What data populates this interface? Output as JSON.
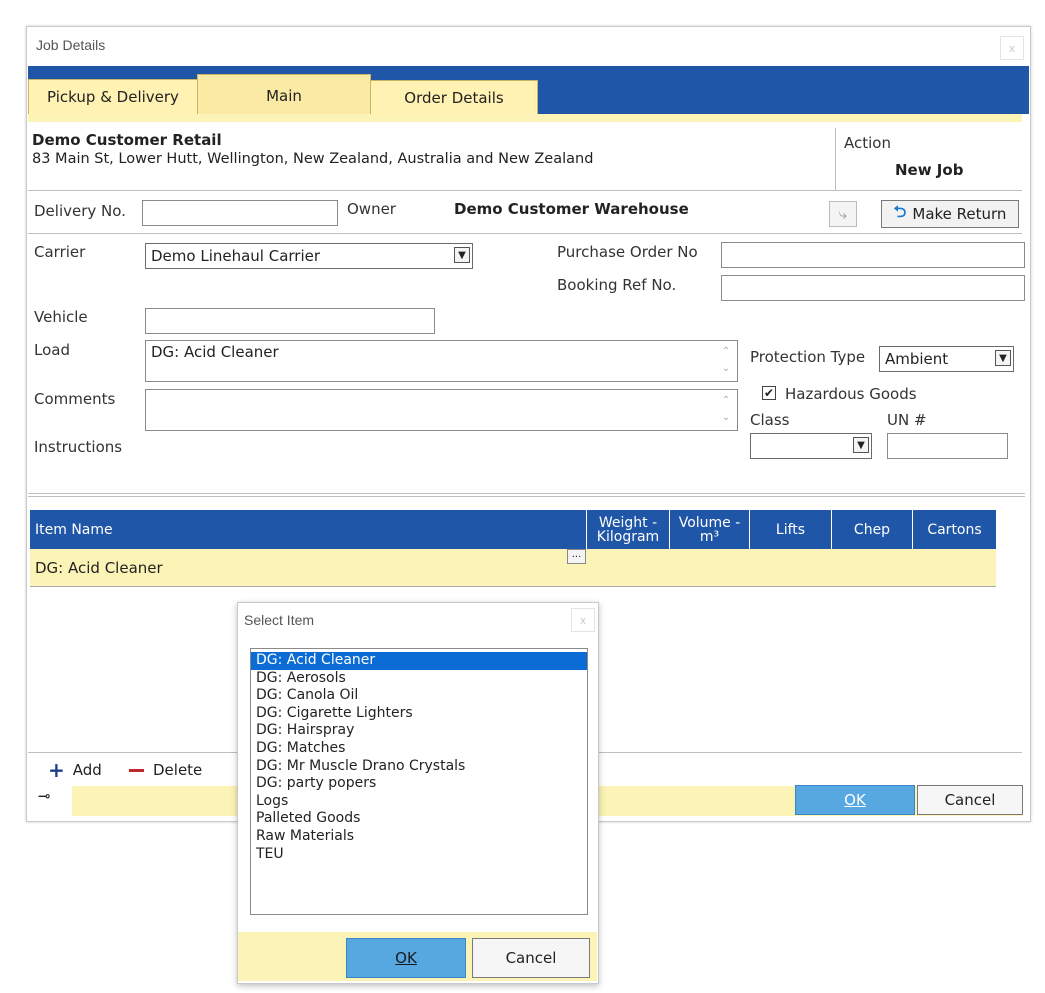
{
  "window": {
    "title": "Job Details"
  },
  "tabs": [
    {
      "label": "Pickup & Delivery"
    },
    {
      "label": "Main"
    },
    {
      "label": "Order Details"
    }
  ],
  "customer": {
    "name": "Demo Customer Retail",
    "address": "83 Main St, Lower Hutt, Wellington, New Zealand, Australia and New Zealand"
  },
  "action": {
    "label": "Action",
    "value": "New Job"
  },
  "delivery": {
    "label": "Delivery No.",
    "value": ""
  },
  "owner": {
    "label": "Owner",
    "value": "Demo Customer Warehouse"
  },
  "make_return": "Make Return",
  "carrier": {
    "label": "Carrier",
    "value": "Demo Linehaul Carrier"
  },
  "purchase_order": {
    "label": "Purchase Order No",
    "value": ""
  },
  "booking_ref": {
    "label": "Booking Ref No.",
    "value": ""
  },
  "vehicle": {
    "label": "Vehicle",
    "value": ""
  },
  "load": {
    "label": "Load",
    "value": "DG: Acid Cleaner"
  },
  "comments": {
    "label": "Comments",
    "value": ""
  },
  "instructions": {
    "label": "Instructions"
  },
  "protection": {
    "label": "Protection Type",
    "value": "Ambient"
  },
  "hazardous": {
    "label": "Hazardous Goods",
    "checked": true
  },
  "class_field": {
    "label": "Class",
    "value": ""
  },
  "un_field": {
    "label": "UN #",
    "value": ""
  },
  "grid": {
    "columns": [
      "Item Name",
      "Weight - Kilogram",
      "Volume - m³",
      "Lifts",
      "Chep",
      "Cartons"
    ],
    "rows": [
      {
        "item": "DG: Acid Cleaner"
      }
    ],
    "ellipsis": "..."
  },
  "footer": {
    "add": "Add",
    "delete": "Delete",
    "ok": "OK",
    "cancel": "Cancel"
  },
  "select_dialog": {
    "title": "Select Item",
    "items": [
      "DG: Acid Cleaner",
      "DG: Aerosols",
      "DG: Canola Oil",
      "DG: Cigarette Lighters",
      "DG: Hairspray",
      "DG: Matches",
      "DG: Mr Muscle Drano Crystals",
      "DG: party popers",
      "Logs",
      "Palleted Goods",
      "Raw Materials",
      "TEU"
    ],
    "selected_index": 0,
    "ok": "OK",
    "cancel": "Cancel"
  },
  "colors": {
    "accent_blue": "#1f56a8",
    "pale_yellow": "#fcf3b6",
    "select_blue": "#0a6cd4"
  }
}
